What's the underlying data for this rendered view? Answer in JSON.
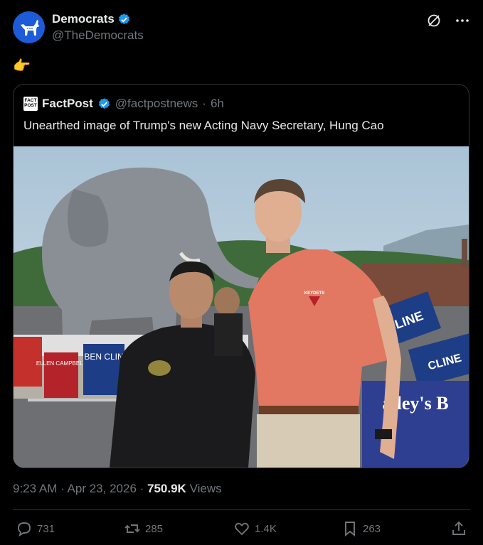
{
  "author": {
    "name": "Democrats",
    "handle": "@TheDemocrats",
    "avatar_color": "#1d5bd8",
    "verified_color": "#1d9bf0"
  },
  "post_text": "👉",
  "quote": {
    "logo_text": "FACT POST",
    "name": "FactPost",
    "handle": "@factpostnews",
    "separator": "·",
    "time": "6h",
    "text": "Unearthed image of Trump's new Acting Navy Secretary, Hung Cao",
    "photo_signs": {
      "sign_left_1": "ELLEN CAMPBELL",
      "sign_left_2": "BEN CLIN",
      "sign_right_1": "CLINE",
      "sign_right_2": "CLINE",
      "banner": "alley's B",
      "shirt_logo": "KEYDETS"
    }
  },
  "meta": {
    "time": "9:23 AM",
    "sep1": " · ",
    "date": "Apr 23, 2026",
    "sep2": " · ",
    "views": "750.9K",
    "views_label": " Views"
  },
  "actions": {
    "replies": "731",
    "reposts": "285",
    "likes": "1.4K",
    "bookmarks": "263"
  },
  "icons": [
    "donkey-logo-icon",
    "verified-badge-icon",
    "grok-icon",
    "more-icon",
    "reply-icon",
    "repost-icon",
    "like-icon",
    "bookmark-icon",
    "share-icon"
  ]
}
